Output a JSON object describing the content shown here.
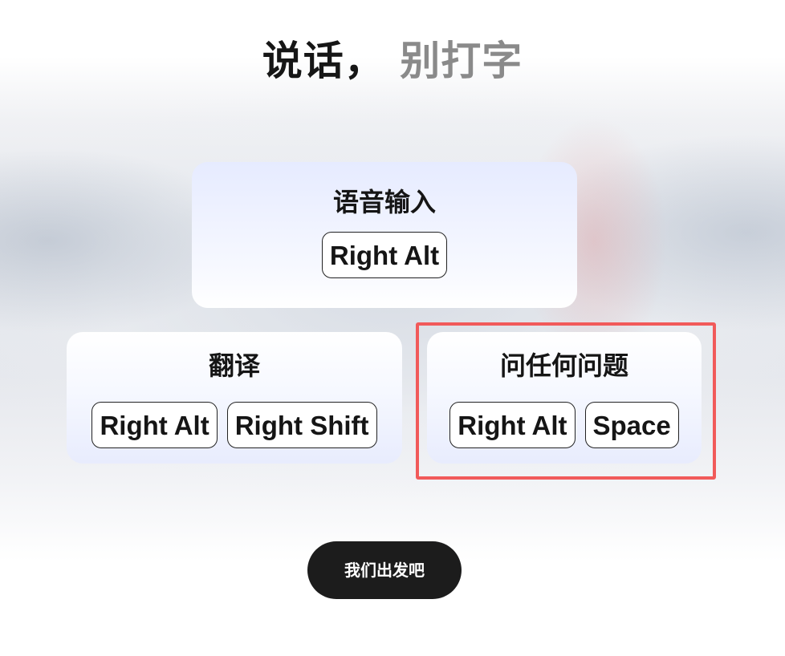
{
  "headline": {
    "main": "说话，",
    "muted": "别打字"
  },
  "cards": [
    {
      "title": "语音输入",
      "keys": [
        "Right Alt"
      ]
    },
    {
      "title": "翻译",
      "keys": [
        "Right Alt",
        "Right Shift"
      ]
    },
    {
      "title": "问任何问题",
      "keys": [
        "Right Alt",
        "Space"
      ]
    }
  ],
  "cta": {
    "label": "我们出发吧"
  },
  "colors": {
    "highlight_border": "#f15a5a",
    "cta_background": "#1c1c1c",
    "headline_muted": "#8a8a8a"
  }
}
